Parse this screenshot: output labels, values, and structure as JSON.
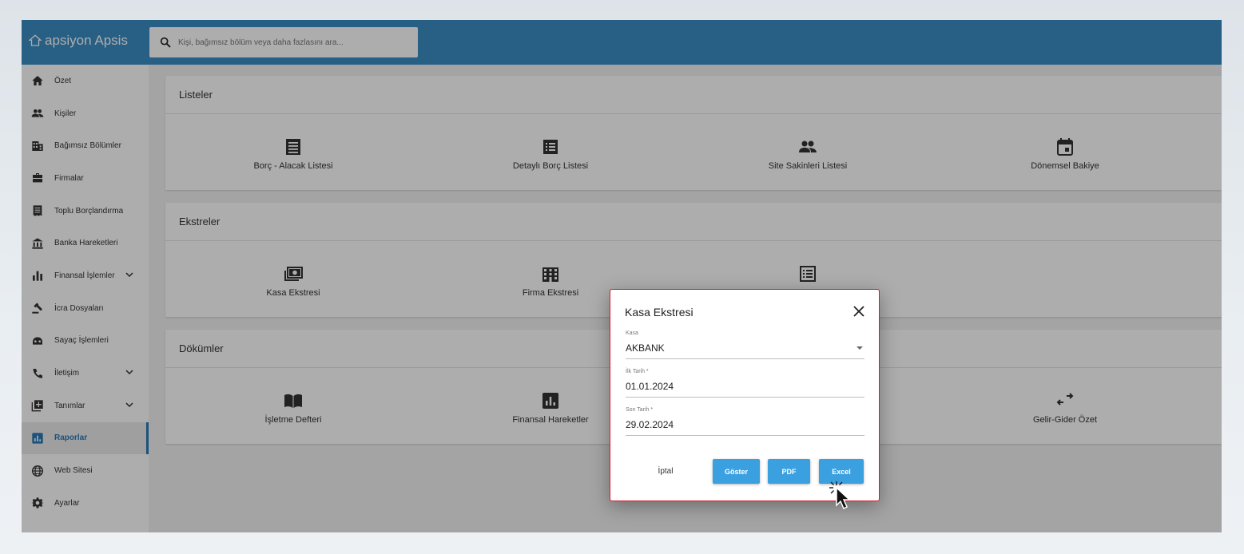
{
  "app": {
    "logo": "apsiyon Apsis"
  },
  "search": {
    "placeholder": "Kişi, bağımsız bölüm veya daha fazlasını ara..."
  },
  "sidebar": {
    "items": [
      {
        "label": "Özet",
        "icon": "home-icon"
      },
      {
        "label": "Kişiler",
        "icon": "people-icon"
      },
      {
        "label": "Bağımsız Bölümler",
        "icon": "building-icon"
      },
      {
        "label": "Firmalar",
        "icon": "briefcase-icon"
      },
      {
        "label": "Toplu Borçlandırma",
        "icon": "receipt-icon"
      },
      {
        "label": "Banka Hareketleri",
        "icon": "bank-icon"
      },
      {
        "label": "Finansal İşlemler",
        "icon": "bar-chart-icon",
        "expandable": true
      },
      {
        "label": "İcra Dosyaları",
        "icon": "gavel-icon"
      },
      {
        "label": "Sayaç İşlemleri",
        "icon": "meter-icon"
      },
      {
        "label": "İletişim",
        "icon": "phone-icon",
        "expandable": true
      },
      {
        "label": "Tanımlar",
        "icon": "library-add-icon",
        "expandable": true
      },
      {
        "label": "Raporlar",
        "icon": "report-icon",
        "active": true
      },
      {
        "label": "Web Sitesi",
        "icon": "globe-icon"
      },
      {
        "label": "Ayarlar",
        "icon": "gear-icon"
      }
    ]
  },
  "sections": {
    "listeler": {
      "title": "Listeler",
      "tiles": [
        "Borç - Alacak Listesi",
        "Detaylı Borç Listesi",
        "Site Sakinleri Listesi",
        "Dönemsel Bakiye"
      ]
    },
    "ekstreler": {
      "title": "Ekstreler",
      "tiles": [
        "Kasa Ekstresi",
        "Firma Ekstresi",
        ""
      ]
    },
    "dokumler": {
      "title": "Dökümler",
      "tiles": [
        "İşletme Defteri",
        "Finansal Hareketler",
        "Gelir-Gider Özet"
      ]
    }
  },
  "dialog": {
    "title": "Kasa Ekstresi",
    "kasa_label": "Kasa",
    "kasa_value": "AKBANK",
    "start_label": "İlk Tarih *",
    "start_value": "01.01.2024",
    "end_label": "Son Tarih *",
    "end_value": "29.02.2024",
    "cancel": "İptal",
    "show": "Göster",
    "pdf": "PDF",
    "excel": "Excel"
  },
  "colors": {
    "topbar": "#3a8cc4",
    "accent": "#2a7ab6",
    "button": "#3aa0e0",
    "dialog_border": "#d0212c"
  }
}
